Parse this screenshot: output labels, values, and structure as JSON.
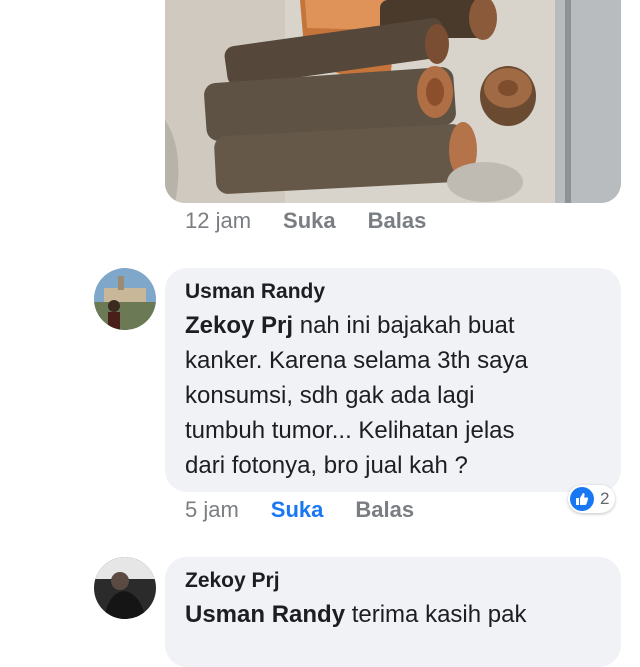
{
  "photo_comment": {
    "image_icon": "wooden-logs-photo",
    "time": "12 jam",
    "like_label": "Suka",
    "reply_label": "Balas"
  },
  "comment1": {
    "author": "Usman Randy",
    "mention": "Zekoy Prj",
    "lines": [
      " nah ini bajakah buat",
      "kanker. Karena selama 3th saya",
      "konsumsi, sdh gak ada lagi",
      "tumbuh tumor... Kelihatan jelas",
      "dari fotonya, bro jual kah ?"
    ],
    "time": "5 jam",
    "like_label": "Suka",
    "reply_label": "Balas",
    "reaction_icon": "thumbs-up-icon",
    "reaction_count": "2",
    "accent_color": "#1877f2"
  },
  "comment2": {
    "author": "Zekoy Prj",
    "mention": "Usman Randy",
    "text": " terima kasih pak"
  }
}
